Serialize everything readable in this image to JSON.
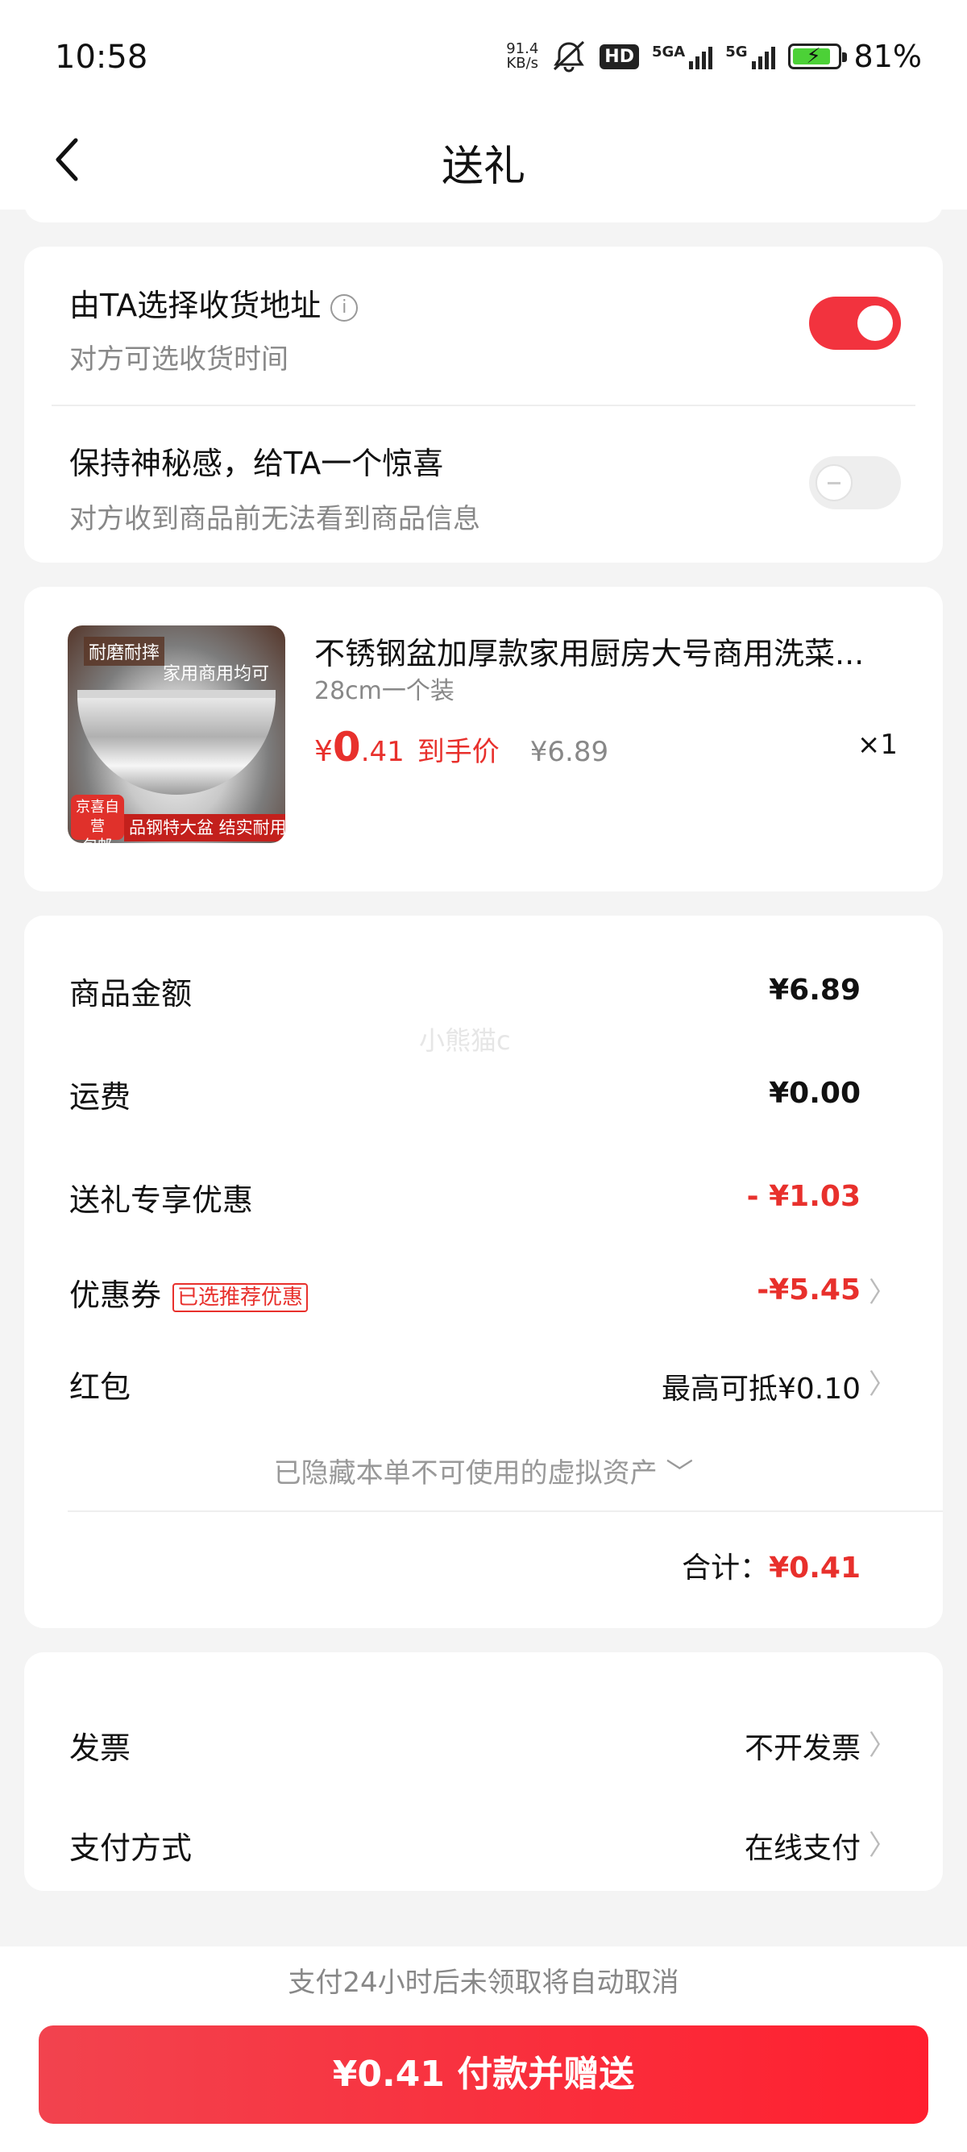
{
  "status_bar": {
    "time": "10:58",
    "net_speed_value": "91.4",
    "net_speed_unit": "KB/s",
    "hd_badge": "HD",
    "signal1_label": "5GA",
    "signal2_label": "5G",
    "battery_percent": "81%",
    "icons": [
      "mute-icon",
      "hd-icon",
      "signal-icon",
      "battery-charging-icon"
    ]
  },
  "header": {
    "title": "送礼",
    "back_icon": "chevron-left-icon"
  },
  "gift_options": {
    "choose_address": {
      "title": "由TA选择收货地址",
      "subtitle": "对方可选收货时间",
      "enabled": true,
      "info_icon": "info-circle-icon"
    },
    "surprise": {
      "title": "保持神秘感，给TA一个惊喜",
      "subtitle": "对方收到商品前无法看到商品信息",
      "enabled": false
    }
  },
  "product": {
    "image_texts": {
      "top_tag": "耐磨耐摔",
      "sub_tag": "家用商用均可",
      "badge_line1": "京喜自营",
      "badge_line2": "包邮",
      "bottom_banner": "品钢特大盆 结实耐用"
    },
    "name": "不锈钢盆加厚款家用厨房大号商用洗菜...",
    "spec": "28cm一个装",
    "price_symbol": "¥",
    "price_int": "0",
    "price_dec": ".41",
    "price_label": "到手价",
    "original_price": "¥6.89",
    "quantity": "×1"
  },
  "summary": {
    "watermark": "小熊猫c",
    "rows": [
      {
        "label": "商品金额",
        "value": "¥6.89"
      },
      {
        "label": "运费",
        "value": "¥0.00"
      },
      {
        "label": "送礼专享优惠",
        "value": "- ¥1.03"
      },
      {
        "label": "优惠券",
        "badge": "已选推荐优惠",
        "value": "-¥5.45"
      },
      {
        "label": "红包",
        "value": "最高可抵¥0.10"
      }
    ],
    "hidden_assets": "已隐藏本单不可使用的虚拟资产",
    "total_label": "合计：",
    "total_value": "¥0.41"
  },
  "extra": {
    "invoice_label": "发票",
    "invoice_value": "不开发票",
    "payment_label": "支付方式",
    "payment_value": "在线支付"
  },
  "notice": "支付24小时后未领取将自动取消",
  "pay_button": "¥0.41 付款并赠送",
  "colors": {
    "accent_red": "#e8302c",
    "toggle_on": "#f2333e",
    "background": "#f4f4f4"
  }
}
